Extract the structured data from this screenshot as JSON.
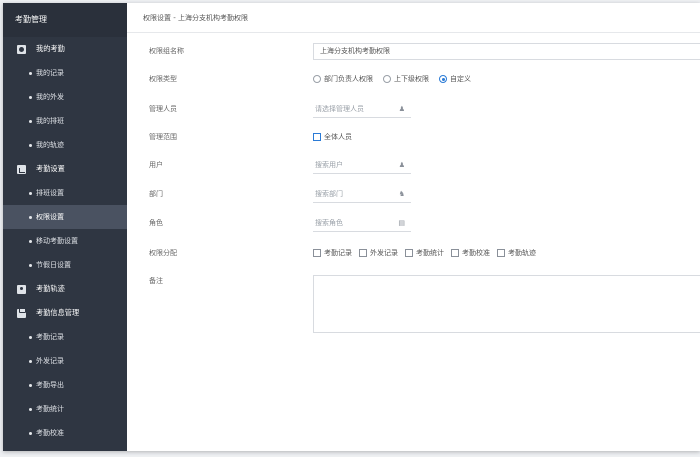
{
  "sidebar": {
    "title": "考勤管理",
    "groups": [
      {
        "label": "我的考勤",
        "icon": "user-icon",
        "items": [
          "我的记录",
          "我的外发",
          "我的排班",
          "我的轨迹"
        ]
      },
      {
        "label": "考勤设置",
        "icon": "chart-icon",
        "items": [
          "排班设置",
          "权限设置",
          "移动考勤设置",
          "节假日设置"
        ]
      },
      {
        "label": "考勤轨迹",
        "icon": "map-icon",
        "items": []
      },
      {
        "label": "考勤信息管理",
        "icon": "clipboard-icon",
        "items": [
          "考勤记录",
          "外发记录",
          "考勤导出",
          "考勤统计",
          "考勤校准"
        ]
      }
    ],
    "active_item": "权限设置"
  },
  "breadcrumb": "权限设置 - 上海分支机构考勤权限",
  "form": {
    "group_name": {
      "label": "权限组名称",
      "value": "上海分支机构考勤权限"
    },
    "perm_type": {
      "label": "权限类型",
      "options": [
        "部门负责人权限",
        "上下级权限",
        "自定义"
      ],
      "selected": "自定义"
    },
    "manager": {
      "label": "管理人员",
      "placeholder": "请选择管理人员"
    },
    "scope": {
      "label": "管理范围",
      "option": "全体人员"
    },
    "user": {
      "label": "用户",
      "placeholder": "搜索用户"
    },
    "dept": {
      "label": "部门",
      "placeholder": "搜索部门"
    },
    "role": {
      "label": "角色",
      "placeholder": "搜索角色"
    },
    "perm_assign": {
      "label": "权限分配",
      "options": [
        "考勤记录",
        "外发记录",
        "考勤统计",
        "考勤校准",
        "考勤轨迹"
      ]
    },
    "note": {
      "label": "备注"
    }
  },
  "colors": {
    "sidebar_bg": "#2f3642",
    "active_bg": "#4a5261",
    "accent": "#2b7bd6"
  }
}
